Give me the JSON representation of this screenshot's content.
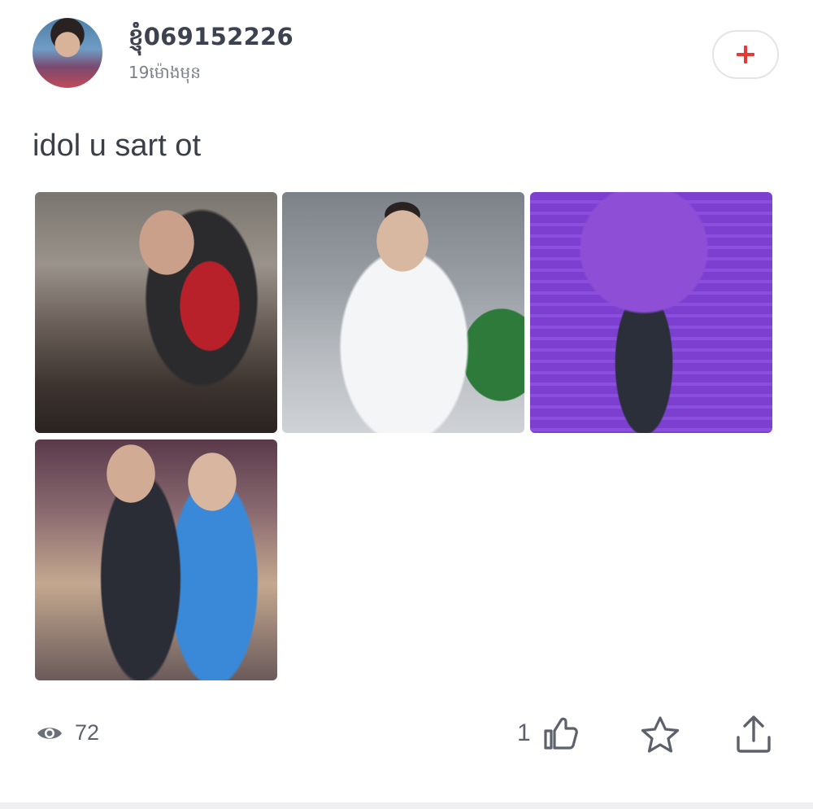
{
  "post": {
    "author": {
      "name": "ខ្ញុំ069152226",
      "timestamp": "19ម៉ោងមុន"
    },
    "text": "idol u sart ot",
    "photos": [
      "photo-1",
      "photo-2",
      "photo-3",
      "photo-4"
    ],
    "stats": {
      "views": "72",
      "likes": "1"
    }
  },
  "icons": {
    "follow": "plus-icon",
    "views": "eye-icon",
    "like": "thumbs-up-icon",
    "favorite": "star-icon",
    "share": "share-icon"
  },
  "colors": {
    "accent": "#e53935",
    "text": "#3a3f47",
    "muted": "#7a7f88",
    "icon": "#5c616b"
  }
}
